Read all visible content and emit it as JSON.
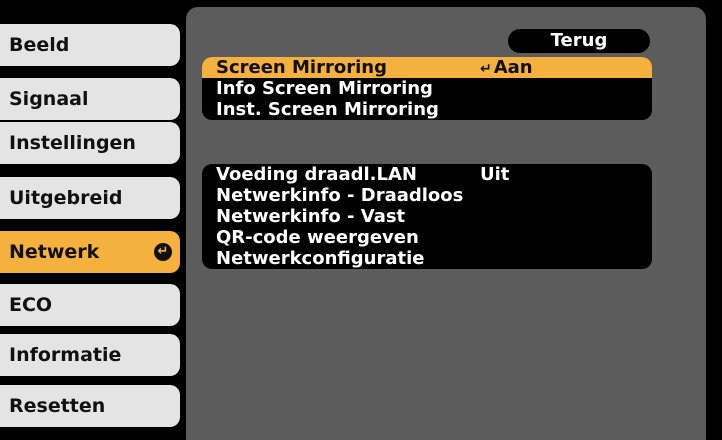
{
  "sidebar": {
    "items": [
      {
        "label": "Beeld"
      },
      {
        "label": "Signaal"
      },
      {
        "label": "Instellingen"
      },
      {
        "label": "Uitgebreid"
      },
      {
        "label": "Netwerk",
        "icon": "enter-icon"
      },
      {
        "label": "ECO"
      },
      {
        "label": "Informatie"
      },
      {
        "label": "Resetten"
      }
    ]
  },
  "panel": {
    "back_label": "Terug",
    "group1": [
      {
        "label": "Screen Mirroring",
        "value": "Aan",
        "value_icon": "enter-icon"
      },
      {
        "label": "Info Screen Mirroring"
      },
      {
        "label": "Inst. Screen Mirroring"
      }
    ],
    "group2": [
      {
        "label": "Voeding draadl.LAN",
        "value": "Uit"
      },
      {
        "label": "Netwerkinfo - Draadloos"
      },
      {
        "label": "Netwerkinfo - Vast"
      },
      {
        "label": "QR-code weergeven"
      },
      {
        "label": "Netwerkconfiguratie"
      }
    ]
  },
  "colors": {
    "accent": "#f4b13e",
    "panel": "#5c5c5c",
    "menu": "#e4e4e4"
  }
}
